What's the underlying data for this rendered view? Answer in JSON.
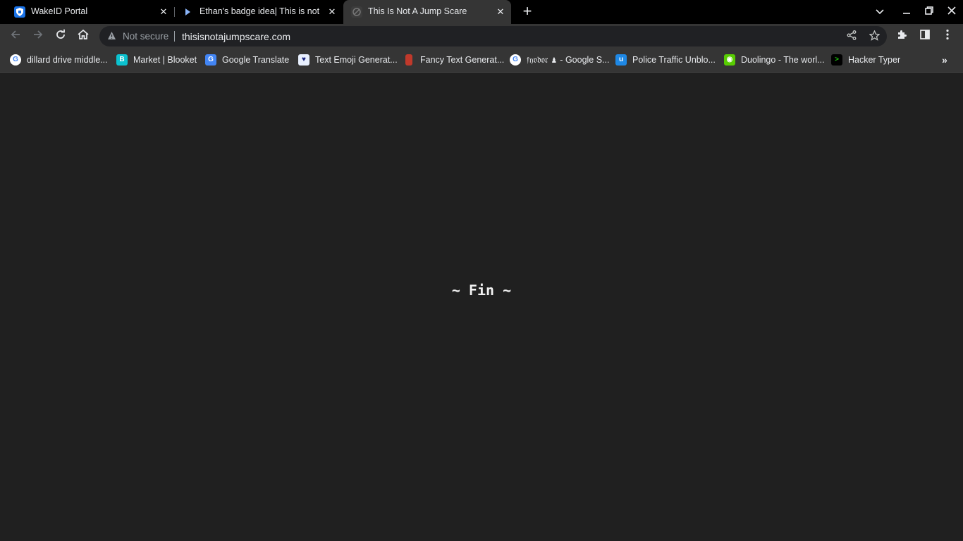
{
  "tabs": [
    {
      "title": "WakeID Portal",
      "icon": "wakeid-shield-icon",
      "active": false
    },
    {
      "title": "Ethan's badge idea| This is not a",
      "icon": "play-arrow-icon",
      "active": false
    },
    {
      "title": "This Is Not A Jump Scare",
      "icon": "site-favicon-icon",
      "active": true
    }
  ],
  "omnibox": {
    "security_label": "Not secure",
    "url": "thisisnotajumpscare.com"
  },
  "bookmarks": [
    {
      "label": "dillard drive middle...",
      "icon": "google-icon",
      "color": "#ffffff"
    },
    {
      "label": "Market | Blooket",
      "icon": "blooket-icon",
      "color": "#0bc2cf"
    },
    {
      "label": "Google Translate",
      "icon": "google-translate-icon",
      "color": "#4285f4"
    },
    {
      "label": "Text Emoji Generat...",
      "icon": "heart-icon",
      "color": "#e8f0fe"
    },
    {
      "label": "Fancy Text Generat...",
      "icon": "jar-icon",
      "color": "#c0392b"
    },
    {
      "label": "𝔣𝔶𝔳𝔡𝔬𝔯 ♟ - Google S...",
      "icon": "google-icon",
      "color": "#ffffff"
    },
    {
      "label": "Police Traffic Unblo...",
      "icon": "unblocked-icon",
      "color": "#1e88e5"
    },
    {
      "label": "Duolingo - The worl...",
      "icon": "duolingo-icon",
      "color": "#58cc02"
    },
    {
      "label": "Hacker Typer",
      "icon": "terminal-icon",
      "color": "#000000"
    }
  ],
  "page": {
    "message": "~ Fin ~"
  },
  "colors": {
    "page_background": "#202020",
    "toolbar": "#353535",
    "tabstrip": "#000000"
  }
}
